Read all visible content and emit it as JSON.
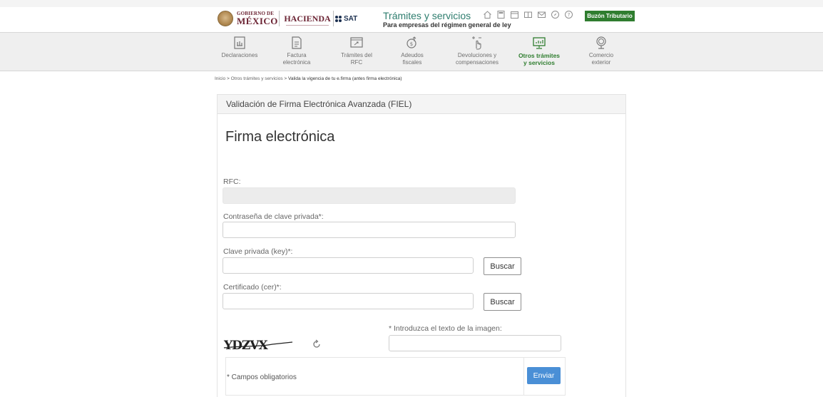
{
  "header": {
    "gob_small": "GOBIERNO DE",
    "gob_big": "MÉXICO",
    "hacienda": "HACIENDA",
    "sat": "SAT",
    "title": "Trámites y servicios",
    "subtitle": "Para empresas del régimen general de ley",
    "icons": [
      "home-icon",
      "calculator-icon",
      "calendar-icon",
      "book-icon",
      "mail-icon",
      "compass-icon",
      "help-icon"
    ],
    "buzon": "Buzón Tributario",
    "accent": "#2f7d2f",
    "brand": "#6b2333"
  },
  "nav": {
    "items": [
      {
        "label1": "Declaraciones",
        "label2": "",
        "icon": "declarations-icon"
      },
      {
        "label1": "Factura",
        "label2": "electrónica",
        "icon": "invoice-icon"
      },
      {
        "label1": "Trámites del",
        "label2": "RFC",
        "icon": "rfc-icon"
      },
      {
        "label1": "Adeudos",
        "label2": "fiscales",
        "icon": "debts-icon"
      },
      {
        "label1": "Devoluciones y",
        "label2": "compensaciones",
        "icon": "refunds-icon"
      },
      {
        "label1": "Otros trámites",
        "label2": "y servicios",
        "icon": "other-services-icon"
      },
      {
        "label1": "Comercio",
        "label2": "exterior",
        "icon": "foreign-trade-icon"
      }
    ]
  },
  "breadcrumb": {
    "home": "Inicio",
    "sep": " > ",
    "section": "Otros trámites y servicios",
    "current": "Valida la vigencia de tu e.firma (antes firma electrónica)"
  },
  "panel": {
    "heading": "Validación de Firma Electrónica Avanzada (FIEL)",
    "form_title": "Firma electrónica"
  },
  "form": {
    "rfc_label": "RFC:",
    "rfc_value": "",
    "password_label": "Contraseña de clave privada*:",
    "password_value": "",
    "key_label": "Clave privada (key)*:",
    "key_value": "",
    "cert_label": "Certificado (cer)*:",
    "cert_value": "",
    "buscar": "Buscar",
    "captcha_text": "YDZVX",
    "captcha_label": "* Introduzca el texto de la imagen:",
    "captcha_value": "",
    "required_note": "* Campos obligatorios",
    "submit": "Enviar",
    "submit_color": "#4a8fd6"
  }
}
